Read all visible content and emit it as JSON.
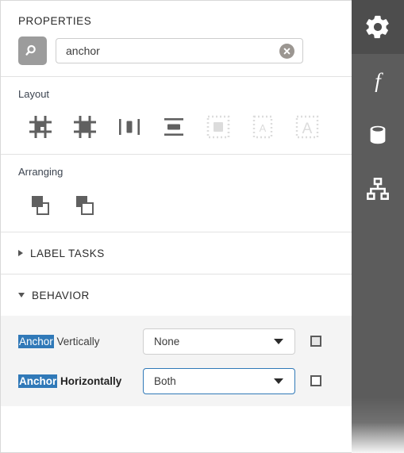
{
  "panel": {
    "title": "PROPERTIES"
  },
  "search": {
    "icon": "search-icon",
    "value": "anchor",
    "placeholder": "Search",
    "clear_icon": "clear-circle-icon"
  },
  "groups": [
    {
      "label": "Layout",
      "items": [
        {
          "name": "align-grid-partial-icon",
          "enabled": true
        },
        {
          "name": "align-grid-fill-icon",
          "enabled": true
        },
        {
          "name": "center-vertically-icon",
          "enabled": true
        },
        {
          "name": "center-horizontally-icon",
          "enabled": true
        },
        {
          "name": "fit-container-icon",
          "enabled": false
        },
        {
          "name": "shrink-text-icon",
          "enabled": false
        },
        {
          "name": "grow-text-icon",
          "enabled": false
        }
      ]
    },
    {
      "label": "Arranging",
      "items": [
        {
          "name": "bring-to-front-icon",
          "enabled": true
        },
        {
          "name": "send-to-back-icon",
          "enabled": true
        }
      ]
    }
  ],
  "sections": [
    {
      "title": "LABEL TASKS",
      "expanded": false
    },
    {
      "title": "BEHAVIOR",
      "expanded": true
    }
  ],
  "behavior": {
    "rows": [
      {
        "label_match": "Anchor",
        "label_rest": " Vertically",
        "bold": false,
        "value": "None",
        "focused": false,
        "checked": false,
        "checkbox_style": "filled"
      },
      {
        "label_match": "Anchor",
        "label_rest": " Horizontally",
        "bold": true,
        "value": "Both",
        "focused": true,
        "checked": false,
        "checkbox_style": "plain"
      }
    ]
  },
  "rail": {
    "items": [
      {
        "name": "gear-icon",
        "label": "Properties",
        "active": true
      },
      {
        "name": "function-icon",
        "label": "Expressions",
        "active": false
      },
      {
        "name": "database-icon",
        "label": "Data Sources",
        "active": false
      },
      {
        "name": "hierarchy-icon",
        "label": "Structure",
        "active": false
      }
    ]
  },
  "colors": {
    "accent": "#3079b8",
    "rail_bg": "#5c5c5c",
    "rail_active_bg": "#4d4d4d",
    "section_bg": "#f4f4f4",
    "icon_enabled": "#606060",
    "icon_disabled": "#dcdcdc"
  }
}
